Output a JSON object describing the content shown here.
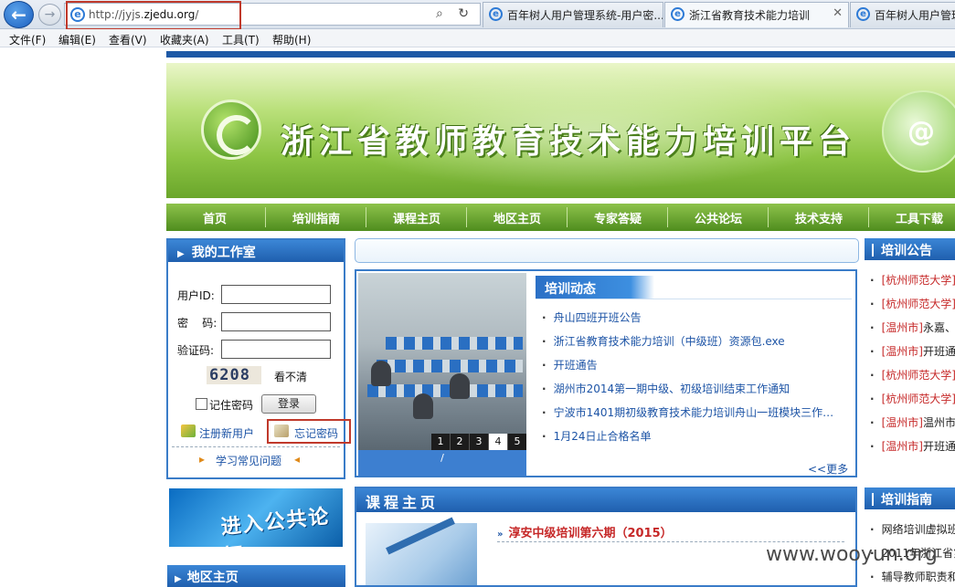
{
  "browser": {
    "url_prefix": "http://jyjs.",
    "url_domain": "zjedu.org",
    "url_suffix": "/",
    "tabs": [
      {
        "label": "百年树人用户管理系统-用户密...",
        "active": false
      },
      {
        "label": "浙江省教育技术能力培训",
        "active": true
      },
      {
        "label": "百年树人用户管理系统",
        "active": false
      }
    ],
    "menu": [
      "文件(F)",
      "编辑(E)",
      "查看(V)",
      "收藏夹(A)",
      "工具(T)",
      "帮助(H)"
    ]
  },
  "site": {
    "title": "浙江省教师教育技术能力培训平台",
    "nav": [
      "首页",
      "培训指南",
      "课程主页",
      "地区主页",
      "专家答疑",
      "公共论坛",
      "技术支持",
      "工具下载"
    ]
  },
  "workroom": {
    "title": "我的工作室",
    "user_label": "用户ID:",
    "pass_label": "密    码:",
    "captcha_label": "验证码:",
    "captcha_code": "6208",
    "captcha_refresh": "看不清",
    "remember_label": "记住密码",
    "login_button": "登录",
    "register_link": "注册新用户",
    "forgot_link": "忘记密码",
    "faq_link": "学习常见问题"
  },
  "forum_banner": "进入公共论坛",
  "region_title": "地区主页",
  "news": {
    "title": "培训动态",
    "items": [
      "舟山四班开班公告",
      "浙江省教育技术能力培训（中级班）资源包.exe",
      "开班通告",
      "湖州市2014第一期中级、初级培训结束工作通知",
      "宁波市1401期初级教育技术能力培训舟山一班模块三作业...",
      "1月24日止合格名单"
    ],
    "more": "<<更多",
    "slides": [
      "1",
      "2",
      "3",
      "4",
      "5"
    ],
    "active_slide": "4",
    "caption": "/"
  },
  "course": {
    "title": "课程主页",
    "item": "淳安中级培训第六期（2015）"
  },
  "announcements": {
    "title": "培训公告",
    "items": [
      {
        "tag": "[杭州师范大学]",
        "text": ""
      },
      {
        "tag": "[杭州师范大学]",
        "text": ""
      },
      {
        "tag": "[温州市]",
        "text": "永嘉、"
      },
      {
        "tag": "[温州市]",
        "text": "开班通"
      },
      {
        "tag": "[杭州师范大学]",
        "text": ""
      },
      {
        "tag": "[杭州师范大学]",
        "text": ""
      },
      {
        "tag": "[温州市]",
        "text": "温州市"
      },
      {
        "tag": "[温州市]",
        "text": "开班通"
      }
    ]
  },
  "guide": {
    "title": "培训指南",
    "items": [
      "网络培训虚拟班",
      "2011年浙江省第",
      "辅导教师职责和"
    ]
  },
  "watermark": "www.wooyun.org"
}
